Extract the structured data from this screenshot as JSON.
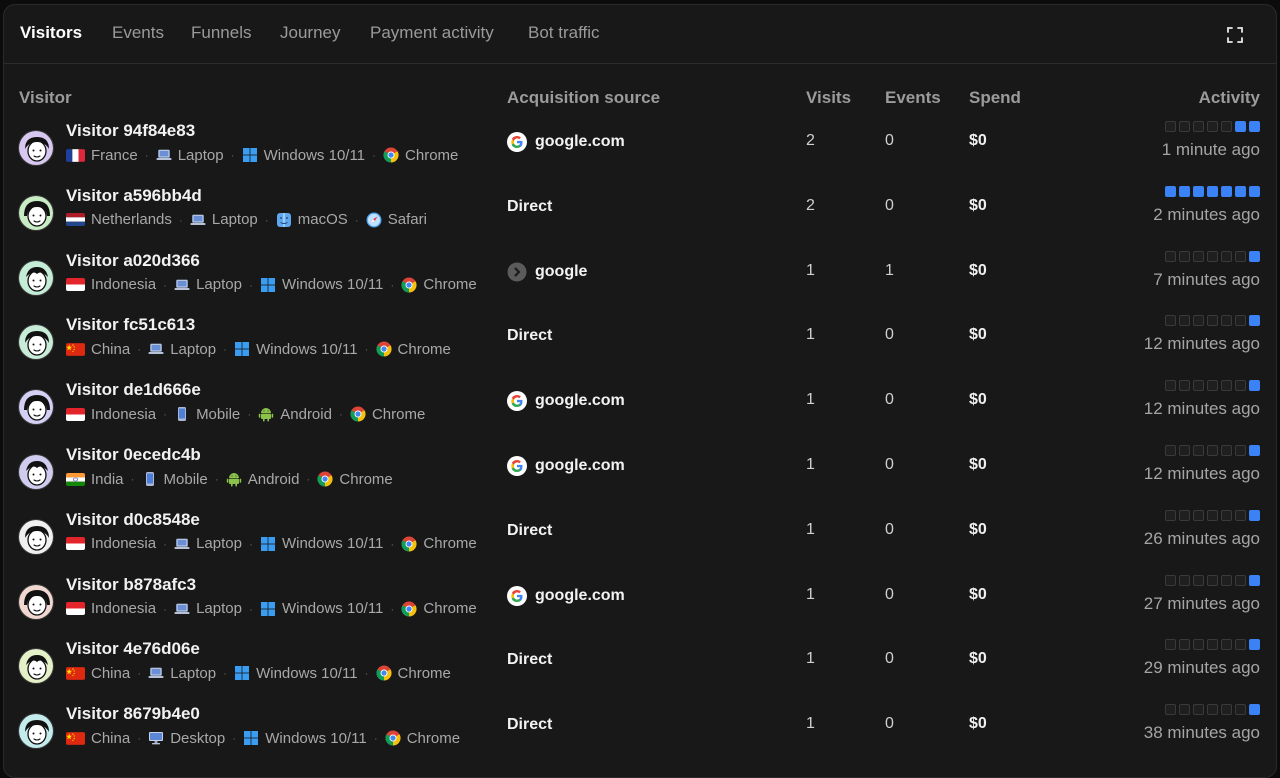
{
  "tabs": [
    {
      "label": "Visitors",
      "active": true
    },
    {
      "label": "Events",
      "active": false
    },
    {
      "label": "Funnels",
      "active": false
    },
    {
      "label": "Journey",
      "active": false
    },
    {
      "label": "Payment activity",
      "active": false
    },
    {
      "label": "Bot traffic",
      "active": false
    }
  ],
  "columns": {
    "visitor": "Visitor",
    "source": "Acquisition source",
    "visits": "Visits",
    "events": "Events",
    "spend": "Spend",
    "activity": "Activity"
  },
  "colors": {
    "accent": "#3b82f6",
    "background": "#181818"
  },
  "icons": {
    "fullscreen": "fullscreen-icon"
  },
  "rows": [
    {
      "name": "Visitor 94f84e83",
      "country": "France",
      "flag": "fr",
      "device": "Laptop",
      "device_icon": "laptop-icon",
      "os": "Windows 10/11",
      "os_icon": "windows-icon",
      "browser": "Chrome",
      "browser_icon": "chrome-icon",
      "source": "google.com",
      "source_icon": "google-icon",
      "visits": "2",
      "events": "0",
      "spend": "$0",
      "activity_on": [
        5,
        6
      ],
      "ago": "1 minute ago",
      "avatar_bg": "#d8c8f0"
    },
    {
      "name": "Visitor a596bb4d",
      "country": "Netherlands",
      "flag": "nl",
      "device": "Laptop",
      "device_icon": "laptop-icon",
      "os": "macOS",
      "os_icon": "finder-icon",
      "browser": "Safari",
      "browser_icon": "safari-icon",
      "source": "Direct",
      "source_icon": "",
      "visits": "2",
      "events": "0",
      "spend": "$0",
      "activity_on": [
        0,
        1,
        2,
        3,
        4,
        5,
        6
      ],
      "ago": "2 minutes ago",
      "avatar_bg": "#c8ecc4"
    },
    {
      "name": "Visitor a020d366",
      "country": "Indonesia",
      "flag": "id",
      "device": "Laptop",
      "device_icon": "laptop-icon",
      "os": "Windows 10/11",
      "os_icon": "windows-icon",
      "browser": "Chrome",
      "browser_icon": "chrome-icon",
      "source": "google",
      "source_icon": "chevron-right-icon",
      "visits": "1",
      "events": "1",
      "spend": "$0",
      "activity_on": [
        6
      ],
      "ago": "7 minutes ago",
      "avatar_bg": "#c4ecd6"
    },
    {
      "name": "Visitor fc51c613",
      "country": "China",
      "flag": "cn",
      "device": "Laptop",
      "device_icon": "laptop-icon",
      "os": "Windows 10/11",
      "os_icon": "windows-icon",
      "browser": "Chrome",
      "browser_icon": "chrome-icon",
      "source": "Direct",
      "source_icon": "",
      "visits": "1",
      "events": "0",
      "spend": "$0",
      "activity_on": [
        6
      ],
      "ago": "12 minutes ago",
      "avatar_bg": "#c8ecd8"
    },
    {
      "name": "Visitor de1d666e",
      "country": "Indonesia",
      "flag": "id",
      "device": "Mobile",
      "device_icon": "mobile-icon",
      "os": "Android",
      "os_icon": "android-icon",
      "browser": "Chrome",
      "browser_icon": "chrome-icon",
      "source": "google.com",
      "source_icon": "google-icon",
      "visits": "1",
      "events": "0",
      "spend": "$0",
      "activity_on": [
        6
      ],
      "ago": "12 minutes ago",
      "avatar_bg": "#d4d0f4"
    },
    {
      "name": "Visitor 0ecedc4b",
      "country": "India",
      "flag": "in",
      "device": "Mobile",
      "device_icon": "mobile-icon",
      "os": "Android",
      "os_icon": "android-icon",
      "browser": "Chrome",
      "browser_icon": "chrome-icon",
      "source": "google.com",
      "source_icon": "google-icon",
      "visits": "1",
      "events": "0",
      "spend": "$0",
      "activity_on": [
        6
      ],
      "ago": "12 minutes ago",
      "avatar_bg": "#d0ccf0"
    },
    {
      "name": "Visitor d0c8548e",
      "country": "Indonesia",
      "flag": "id",
      "device": "Laptop",
      "device_icon": "laptop-icon",
      "os": "Windows 10/11",
      "os_icon": "windows-icon",
      "browser": "Chrome",
      "browser_icon": "chrome-icon",
      "source": "Direct",
      "source_icon": "",
      "visits": "1",
      "events": "0",
      "spend": "$0",
      "activity_on": [
        6
      ],
      "ago": "26 minutes ago",
      "avatar_bg": "#f0f0f0"
    },
    {
      "name": "Visitor b878afc3",
      "country": "Indonesia",
      "flag": "id",
      "device": "Laptop",
      "device_icon": "laptop-icon",
      "os": "Windows 10/11",
      "os_icon": "windows-icon",
      "browser": "Chrome",
      "browser_icon": "chrome-icon",
      "source": "google.com",
      "source_icon": "google-icon",
      "visits": "1",
      "events": "0",
      "spend": "$0",
      "activity_on": [
        6
      ],
      "ago": "27 minutes ago",
      "avatar_bg": "#f0d8d0"
    },
    {
      "name": "Visitor 4e76d06e",
      "country": "China",
      "flag": "cn",
      "device": "Laptop",
      "device_icon": "laptop-icon",
      "os": "Windows 10/11",
      "os_icon": "windows-icon",
      "browser": "Chrome",
      "browser_icon": "chrome-icon",
      "source": "Direct",
      "source_icon": "",
      "visits": "1",
      "events": "0",
      "spend": "$0",
      "activity_on": [
        6
      ],
      "ago": "29 minutes ago",
      "avatar_bg": "#e4f0c8"
    },
    {
      "name": "Visitor 8679b4e0",
      "country": "China",
      "flag": "cn",
      "device": "Desktop",
      "device_icon": "desktop-icon",
      "os": "Windows 10/11",
      "os_icon": "windows-icon",
      "browser": "Chrome",
      "browser_icon": "chrome-icon",
      "source": "Direct",
      "source_icon": "",
      "visits": "1",
      "events": "0",
      "spend": "$0",
      "activity_on": [
        6
      ],
      "ago": "38 minutes ago",
      "avatar_bg": "#c4ecec"
    }
  ]
}
